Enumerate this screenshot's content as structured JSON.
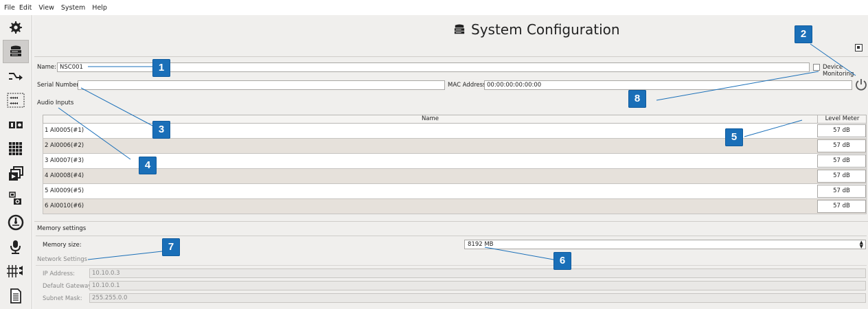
{
  "menu": [
    "File",
    "Edit",
    "View",
    "System",
    "Help"
  ],
  "sidebar": [
    {
      "icon": "gear-icon"
    },
    {
      "icon": "server-icon",
      "active": true
    },
    {
      "icon": "route-arrow-icon"
    },
    {
      "icon": "audio-channels-icon"
    },
    {
      "icon": "io-icon"
    },
    {
      "icon": "matrix-grid-icon"
    },
    {
      "icon": "media-player-icon"
    },
    {
      "icon": "scheduler-icon"
    },
    {
      "icon": "gauge-icon"
    },
    {
      "icon": "microphone-icon"
    },
    {
      "icon": "mixer-icon"
    },
    {
      "icon": "document-icon"
    }
  ],
  "header": {
    "title": "System Configuration"
  },
  "general": {
    "name_label": "Name:",
    "name_value": "NSC001",
    "device_monitoring_label": "Device Monitoring",
    "serial_label": "Serial Number:",
    "serial_value": "",
    "mac_label": "MAC Address:",
    "mac_value": "00:00:00:00:00:00"
  },
  "audio_inputs": {
    "title": "Audio Inputs",
    "columns": [
      "Name",
      "Level Meter"
    ],
    "rows": [
      {
        "num": "1",
        "name": "AI0005(#1)",
        "level": "57 dB"
      },
      {
        "num": "2",
        "name": "AI0006(#2)",
        "level": "57 dB"
      },
      {
        "num": "3",
        "name": "AI0007(#3)",
        "level": "57 dB"
      },
      {
        "num": "4",
        "name": "AI0008(#4)",
        "level": "57 dB"
      },
      {
        "num": "5",
        "name": "AI0009(#5)",
        "level": "57 dB"
      },
      {
        "num": "6",
        "name": "AI0010(#6)",
        "level": "57 dB"
      }
    ]
  },
  "memory": {
    "title": "Memory settings",
    "size_label": "Memory size:",
    "size_value": "8192 MB"
  },
  "network": {
    "title": "Network Settings",
    "ip_label": "IP Address:",
    "ip_value": "10.10.0.3",
    "gateway_label": "Default Gateway:",
    "gateway_value": "10.10.0.1",
    "subnet_label": "Subnet Mask:",
    "subnet_value": "255.255.0.0"
  },
  "callouts": [
    "1",
    "2",
    "3",
    "4",
    "5",
    "6",
    "7",
    "8"
  ],
  "colors": {
    "callout": "#1a6fb8",
    "row_alt": "#e6e1db",
    "panel_bg": "#f0efed"
  }
}
